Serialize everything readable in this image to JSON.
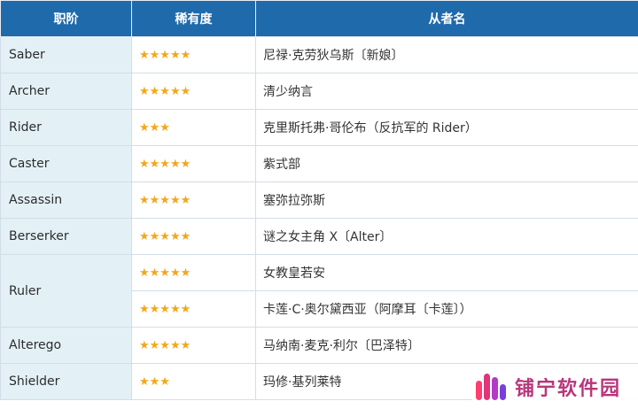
{
  "table": {
    "headers": [
      "职阶",
      "稀有度",
      "从者名"
    ],
    "rows": [
      {
        "class": "Saber",
        "rarity": "★★★★★",
        "name": "尼禄·克劳狄乌斯〔新娘〕"
      },
      {
        "class": "Archer",
        "rarity": "★★★★★",
        "name": "清少纳言"
      },
      {
        "class": "Rider",
        "rarity": "★★★",
        "name": "克里斯托弗·哥伦布（反抗军的 Rider）"
      },
      {
        "class": "Caster",
        "rarity": "★★★★★",
        "name": "紫式部"
      },
      {
        "class": "Assassin",
        "rarity": "★★★★★",
        "name": "塞弥拉弥斯"
      },
      {
        "class": "Berserker",
        "rarity": "★★★★★",
        "name": "谜之女主角 X〔Alter〕"
      },
      {
        "class": "Ruler",
        "rarity": "★★★★★",
        "name": "女教皇若安"
      },
      {
        "class": "",
        "rarity": "★★★★★",
        "name": "卡莲·C·奥尔黛西亚（阿摩耳〔卡莲〕）"
      },
      {
        "class": "Alterego",
        "rarity": "★★★★★",
        "name": "马纳南·麦克·利尔〔巴泽特〕"
      },
      {
        "class": "Shielder",
        "rarity": "★★★",
        "name": "玛修·基列莱特"
      }
    ]
  },
  "watermark": {
    "text": "铺宁软件园",
    "icon": "bar-logo-icon"
  },
  "colors": {
    "header_bg": "#1f6aab",
    "class_cell_bg": "#e3f1f7",
    "star": "#f2a71b",
    "watermark_text": "#b8367c"
  }
}
